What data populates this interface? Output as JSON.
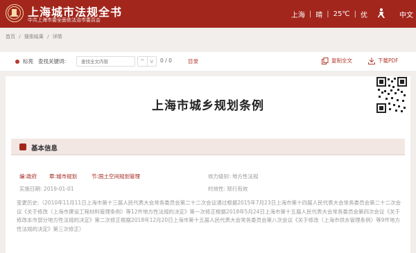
{
  "header": {
    "title": "上海城市法规全书",
    "subtitle": "中共上海市委全面依法治市委员会",
    "city": "上海",
    "weather": "晴",
    "temperature": "25℃",
    "air_quality": "优",
    "separator": "|",
    "language": "中文",
    "accessibility_icon": "accessibility-icon"
  },
  "breadcrumb": [
    "首页",
    "/",
    "搜索结果",
    "/",
    "详情"
  ],
  "toolbar": {
    "mark_label": "标亮",
    "find_label": "查找关键词:",
    "find_placeholder": "查找全文内容",
    "prev": "^",
    "next": "v",
    "count": "0 / 0",
    "toc": "目录",
    "copy_label": "复制全文",
    "download_label": "下载PDF"
  },
  "document": {
    "title": "上海市城乡规划条例",
    "section_title": "基本信息",
    "tags": [
      "编:政府",
      "章:城市规划",
      "节:国土空间规划管理"
    ],
    "effect_label": "效力级别:",
    "effect_value": "地方性法规",
    "date_label": "实施日期:",
    "date_value": "2019-01-01",
    "validity_label": "时效性:",
    "validity_value": "现行有效",
    "history_label": "变更历史:",
    "history_text": "（2010年11月11日上海市第十三届人民代表大会常务委员会第二十二次会议通过根据2015年7月23日上海市第十四届人民代表大会常务委员会第二十二次会议《关于修改〈上海市建设工程材料管理条例〉等12件地方性法规的决定》第一次修正根据2018年5月24日上海市第十五届人民代表大会常务委员会第四次会议《关于修改本市部分地方性法规的决定》第二次修正根据2018年12月20日上海市第十五届人民代表大会常务委员会第八次会议《关于修改〈上海市供水管理条例〉等9件地方性法规的决定》第三次修正）"
  },
  "colors": {
    "brand": "#a2261c",
    "accent": "#b33a2e",
    "section_bg": "#f3e7e4"
  }
}
